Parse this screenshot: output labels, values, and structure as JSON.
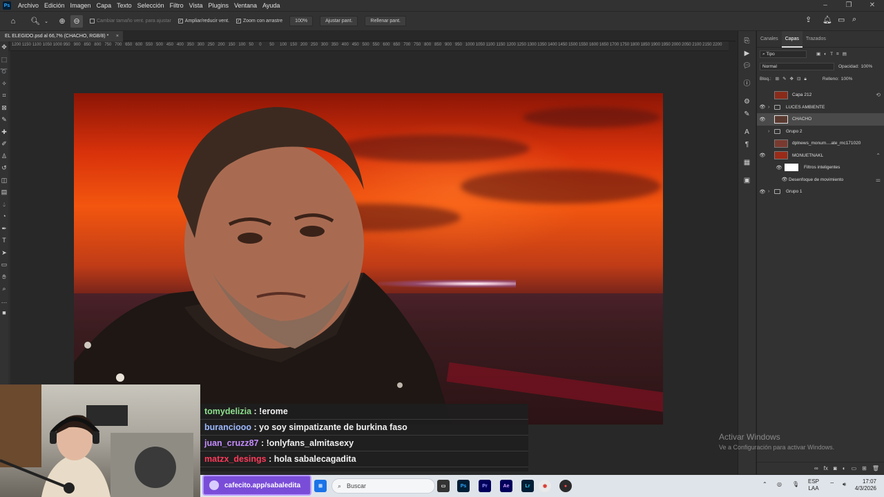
{
  "menu": [
    "Archivo",
    "Edición",
    "Imagen",
    "Capa",
    "Texto",
    "Selección",
    "Filtro",
    "Vista",
    "Plugins",
    "Ventana",
    "Ayuda"
  ],
  "app_logo": "Ps",
  "options": {
    "resize_windows": "Cambiar tamaño vent. para ajustar",
    "zoom_resize": "Ampliar/reducir vent.",
    "scrubby_zoom": "Zoom con arrastre",
    "zoom_value": "100%",
    "fit_screen": "Ajustar pant.",
    "fill_screen": "Rellenar pant."
  },
  "document_tab": {
    "title": "EL ELEGIDO.psd al 66,7% (CHACHO, RGB/8) *",
    "close": "×"
  },
  "ruler_labels": [
    "1200",
    "1150",
    "1100",
    "1050",
    "1000",
    "950",
    "900",
    "850",
    "800",
    "750",
    "700",
    "650",
    "600",
    "550",
    "500",
    "450",
    "400",
    "350",
    "300",
    "250",
    "200",
    "150",
    "100",
    "50",
    "0",
    "50",
    "100",
    "150",
    "200",
    "250",
    "300",
    "350",
    "400",
    "450",
    "500",
    "550",
    "600",
    "650",
    "700",
    "750",
    "800",
    "850",
    "900",
    "950",
    "1000",
    "1050",
    "1100",
    "1150",
    "1200",
    "1250",
    "1300",
    "1350",
    "1400",
    "1450",
    "1500",
    "1550",
    "1600",
    "1650",
    "1700",
    "1750",
    "1800",
    "1850",
    "1900",
    "1950",
    "2000",
    "2050",
    "2100",
    "2150",
    "2200"
  ],
  "panel": {
    "tabs": [
      "Canales",
      "Capas",
      "Trazados"
    ],
    "active_tab": "Capas",
    "filter": "Tipo",
    "blend_mode": "Normal",
    "opacity_label": "Opacidad:",
    "opacity_value": "100%",
    "lock_label": "Bloq.:",
    "fill_label": "Relleno:",
    "fill_value": "100%",
    "layers": [
      {
        "name": "Capa 212",
        "visible": false,
        "kind": "image"
      },
      {
        "name": "LUCES AMBIENTE",
        "visible": true,
        "kind": "group"
      },
      {
        "name": "CHACHO",
        "visible": true,
        "kind": "image",
        "selected": true
      },
      {
        "name": "Grupo 2",
        "visible": false,
        "kind": "group"
      },
      {
        "name": "dplnews_monum....ate_mc171020",
        "visible": false,
        "kind": "image"
      },
      {
        "name": "MONUETNAKL",
        "visible": true,
        "kind": "image"
      },
      {
        "name": "Filtros inteligentes",
        "visible": true,
        "kind": "sub"
      },
      {
        "name": "Desenfoque de movimiento",
        "visible": true,
        "kind": "sub2"
      },
      {
        "name": "Grupo 1",
        "visible": true,
        "kind": "group"
      }
    ]
  },
  "watermark": {
    "line1": "Activar Windows",
    "line2": "Ve a Configuración para activar Windows."
  },
  "chat": [
    {
      "user": "tomydelizia",
      "msg": " : !erome"
    },
    {
      "user": "buranciooo",
      "msg": " : yo soy simpatizante de burkina faso"
    },
    {
      "user": "juan_cruzz87",
      "msg": " : !onlyfans_almitasexy"
    },
    {
      "user": "matzx_desings",
      "msg": " : hola sabalecagadita"
    }
  ],
  "cafecito": "cafecito.app/sabaledita",
  "taskbar": {
    "search": "Buscar",
    "lang1": "ESP",
    "lang2": "LAA",
    "time": "17:07",
    "date": "4/3/2026"
  },
  "colors": {
    "ps_bg": "#282828",
    "panel": "#323232",
    "accent_purple": "#7a4dd8"
  }
}
